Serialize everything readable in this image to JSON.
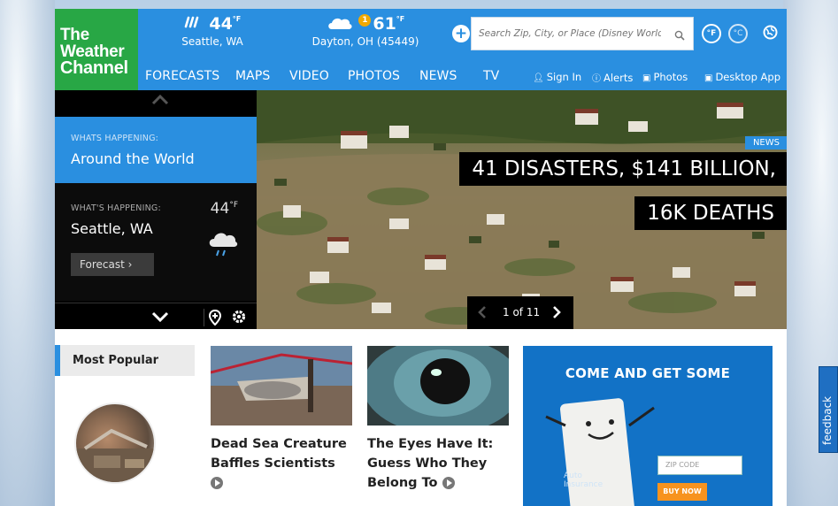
{
  "logo": {
    "line1": "The",
    "line2": "Weather",
    "line3": "Channel"
  },
  "weather": [
    {
      "temp": "44",
      "unit": "°F",
      "city": "Seattle, WA",
      "icon": "rain-icon"
    },
    {
      "temp": "61",
      "unit": "°F",
      "city": "Dayton, OH (45449)",
      "icon": "cloud-icon",
      "alerts": "1"
    }
  ],
  "search": {
    "placeholder": "Search Zip, City, or Place (Disney World)"
  },
  "units": {
    "f": "°F",
    "c": "°C"
  },
  "nav": {
    "items": [
      "FORECASTS",
      "MAPS",
      "VIDEO",
      "PHOTOS",
      "NEWS",
      "TV"
    ]
  },
  "utility": {
    "sign_in": "Sign In",
    "alerts": "Alerts",
    "photos": "Photos",
    "desktop_app": "Desktop App"
  },
  "sidebar": {
    "active": {
      "kicker": "WHATS HAPPENING:",
      "title": "Around the World"
    },
    "local": {
      "kicker": "WHAT'S HAPPENING:",
      "title": "Seattle, WA",
      "temp": "44",
      "unit": "°F",
      "button": "Forecast  ›"
    }
  },
  "hero": {
    "tag": "NEWS",
    "headline_line1": "41 DISASTERS, $141 BILLION,",
    "headline_line2": "16K DEATHS",
    "pager": "1 of 11"
  },
  "most_popular": {
    "heading": "Most Popular"
  },
  "cards": [
    {
      "title": "Dead Sea Creature Baffles Scientists"
    },
    {
      "title": "The Eyes Have It: Guess Who They Belong To"
    }
  ],
  "ad": {
    "headline": "COME AND GET SOME",
    "zip_placeholder": "ZIP CODE",
    "buy_now": "BUY NOW",
    "tagline_1": "Auto",
    "tagline_2": "Insurance"
  },
  "feedback": "feedback",
  "colors": {
    "brand_blue": "#2a8fe0",
    "logo_green": "#28a745",
    "alert_orange": "#f2a900",
    "ad_blue": "#1272c6"
  }
}
